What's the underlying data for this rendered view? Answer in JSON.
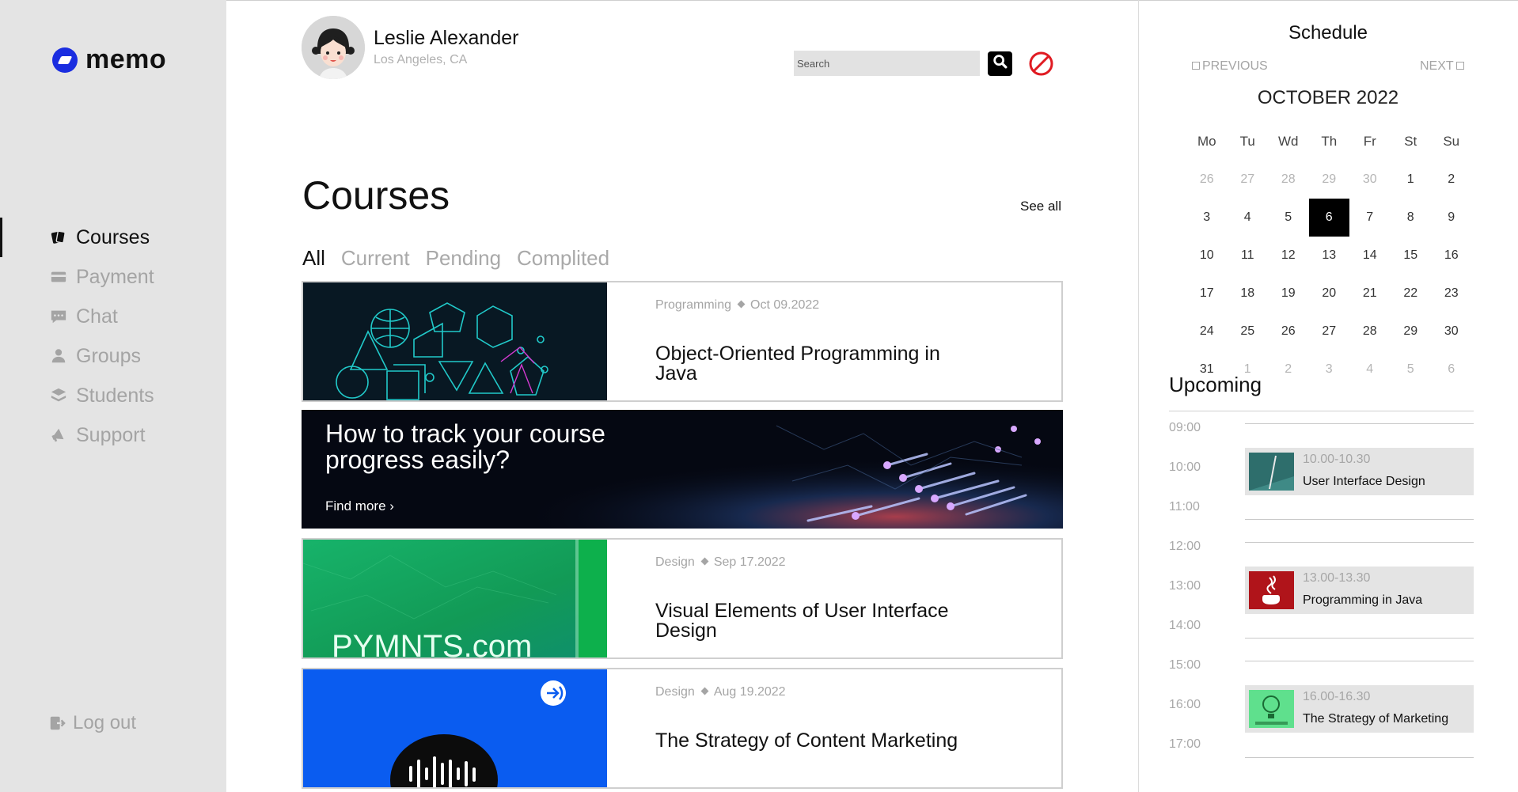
{
  "app": {
    "name": "memo"
  },
  "sidebar": {
    "items": [
      {
        "label": "Courses",
        "icon": "cards-icon",
        "active": true
      },
      {
        "label": "Payment",
        "icon": "credit-card-icon",
        "active": false
      },
      {
        "label": "Chat",
        "icon": "chat-icon",
        "active": false
      },
      {
        "label": "Groups",
        "icon": "user-icon",
        "active": false
      },
      {
        "label": "Students",
        "icon": "layers-icon",
        "active": false
      },
      {
        "label": "Support",
        "icon": "megaphone-icon",
        "active": false
      }
    ],
    "logout_label": "Log out"
  },
  "header": {
    "user_name": "Leslie Alexander",
    "user_location": "Los Angeles, CA",
    "search_placeholder": "Search"
  },
  "courses": {
    "title": "Courses",
    "see_all": "See all",
    "tabs": [
      "All",
      "Current",
      "Pending",
      "Complited"
    ],
    "active_tab": "All",
    "cards": [
      {
        "category": "Programming",
        "date": "Oct 09.2022",
        "title": "Object-Oriented Programming in Java"
      },
      {
        "category": "Design",
        "date": "Sep 17.2022",
        "title": "Visual Elements of User Interface Design"
      },
      {
        "category": "Design",
        "date": "Aug 19.2022",
        "title": "The Strategy of Content Marketing"
      }
    ],
    "banner": {
      "title": "How to track your course progress easily?",
      "link": "Find more"
    },
    "pymnts_text": "PYMNTS.com"
  },
  "schedule": {
    "title": "Schedule",
    "previous": "PREVIOUS",
    "next": "NEXT",
    "month": "OCTOBER 2022",
    "weekdays": [
      "Mo",
      "Tu",
      "Wd",
      "Th",
      "Fr",
      "St",
      "Su"
    ],
    "weeks": [
      [
        "26",
        "27",
        "28",
        "29",
        "30",
        "1",
        "2"
      ],
      [
        "3",
        "4",
        "5",
        "6",
        "7",
        "8",
        "9"
      ],
      [
        "10",
        "11",
        "12",
        "13",
        "14",
        "15",
        "16"
      ],
      [
        "17",
        "18",
        "19",
        "20",
        "21",
        "22",
        "23"
      ],
      [
        "24",
        "25",
        "26",
        "27",
        "28",
        "29",
        "30"
      ],
      [
        "31",
        "1",
        "2",
        "3",
        "4",
        "5",
        "6"
      ]
    ],
    "selected_day": "6",
    "upcoming_title": "Upcoming",
    "times": [
      "09:00",
      "10:00",
      "11:00",
      "12:00",
      "13:00",
      "14:00",
      "15:00",
      "16:00",
      "17:00"
    ],
    "events": [
      {
        "time": "10.00-10.30",
        "title": "User Interface Design"
      },
      {
        "time": "13.00-13.30",
        "title": "Programming in Java"
      },
      {
        "time": "16.00-16.30",
        "title": "The Strategy of Marketing"
      }
    ]
  },
  "colors": {
    "accent": "#1a2de0",
    "sidebar_bg": "#e4e4e4",
    "muted": "#a5a5a5"
  }
}
